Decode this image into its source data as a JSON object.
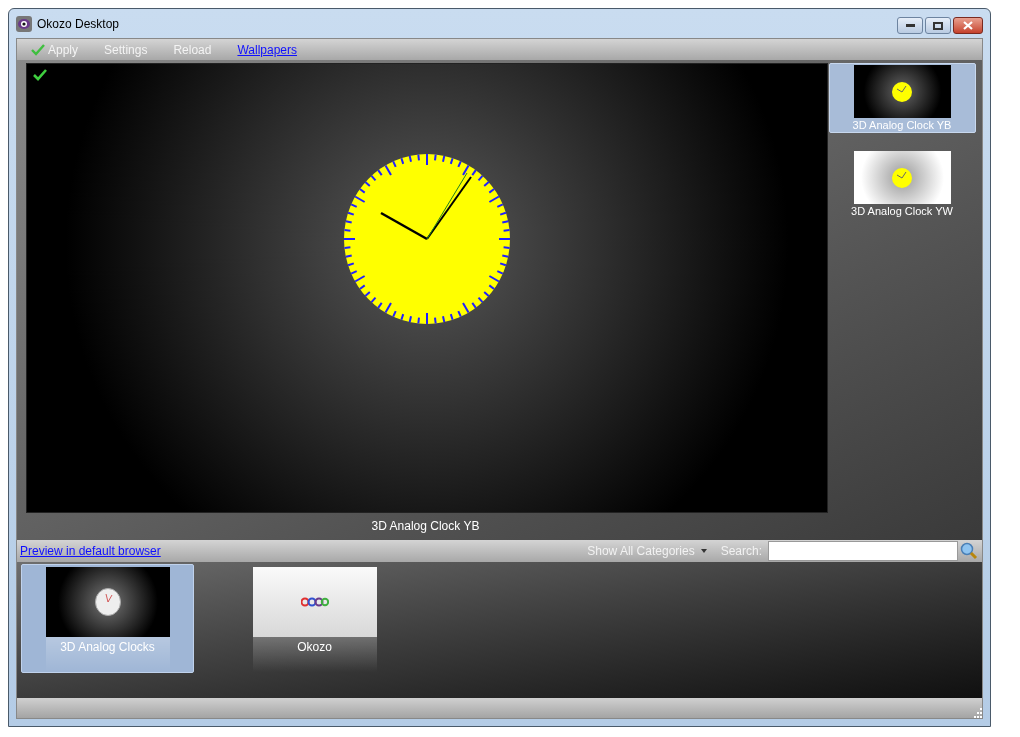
{
  "window": {
    "title": "Okozo Desktop"
  },
  "toolbar": {
    "items": [
      {
        "label": "Apply",
        "kind": "apply"
      },
      {
        "label": "Settings",
        "kind": "button"
      },
      {
        "label": "Reload",
        "kind": "button"
      },
      {
        "label": "Wallpapers",
        "kind": "link"
      }
    ]
  },
  "preview": {
    "applied": true,
    "caption": "3D Analog Clock YB"
  },
  "wallpapers": [
    {
      "label": "3D Analog Clock YB",
      "selected": true,
      "kind": "dark"
    },
    {
      "label": "3D Analog Clock YW",
      "selected": false,
      "kind": "light"
    }
  ],
  "filter_bar": {
    "link": "Preview in default browser",
    "category": "Show All Categories",
    "search_label": "Search:"
  },
  "categories": [
    {
      "label": "3D Analog Clocks",
      "selected": true,
      "kind": "clock"
    },
    {
      "label": "Okozo",
      "selected": false,
      "kind": "logo"
    }
  ]
}
